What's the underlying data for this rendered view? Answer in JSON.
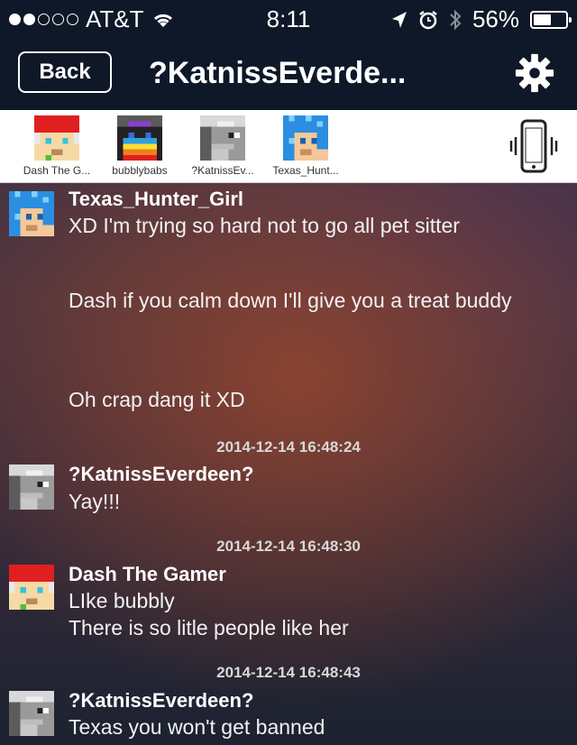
{
  "status_bar": {
    "carrier": "AT&T",
    "time": "8:11",
    "battery": "56%",
    "battery_level": 0.56,
    "signal_bars_filled": 2,
    "signal_bars_total": 5
  },
  "nav": {
    "back_label": "Back",
    "title": "?KatnissEverde...",
    "settings_icon": "gear-icon"
  },
  "members": [
    {
      "name": "Dash The G...",
      "avatar": "red-hat-avatar"
    },
    {
      "name": "bubblybabs",
      "avatar": "rainbow-avatar"
    },
    {
      "name": "?KatnissEv...",
      "avatar": "grey-avatar"
    },
    {
      "name": "Texas_Hunt...",
      "avatar": "blue-avatar"
    }
  ],
  "messages": [
    {
      "sender": "Texas_Hunter_Girl",
      "avatar": "blue-avatar",
      "lines": [
        "XD I'm trying so hard not to go all pet sitter",
        "Dash if you calm down I'll give you a treat buddy",
        "Oh crap dang it XD"
      ]
    },
    {
      "timestamp": "2014-12-14 16:48:24",
      "sender": "?KatnissEverdeen?",
      "avatar": "grey-avatar",
      "lines": [
        "Yay!!!"
      ]
    },
    {
      "timestamp": "2014-12-14 16:48:30",
      "sender": "Dash The Gamer",
      "avatar": "red-hat-avatar",
      "lines": [
        "LIke bubbly",
        "There is so litle people like her"
      ]
    },
    {
      "timestamp": "2014-12-14 16:48:43",
      "sender": "?KatnissEverdeen?",
      "avatar": "grey-avatar",
      "lines": [
        "Texas you won't get banned"
      ]
    }
  ],
  "colors": {
    "nav_background": "#0f1828",
    "member_strip_background": "#ffffff",
    "text": "#ffffff"
  }
}
